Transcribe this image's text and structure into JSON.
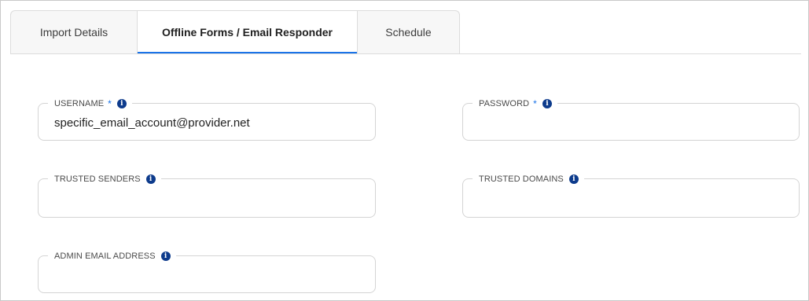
{
  "tabs": [
    {
      "label": "Import Details",
      "active": false
    },
    {
      "label": "Offline Forms / Email Responder",
      "active": true
    },
    {
      "label": "Schedule",
      "active": false
    }
  ],
  "colors": {
    "accent": "#1a73e8",
    "info_icon": "#0d3b8c",
    "border": "#d4d4d4"
  },
  "form": {
    "username": {
      "label": "USERNAME",
      "required_mark": "*",
      "info_icon": "info-icon",
      "value": "specific_email_account@provider.net"
    },
    "password": {
      "label": "PASSWORD",
      "required_mark": "*",
      "info_icon": "info-icon",
      "value": ""
    },
    "trusted_senders": {
      "label": "TRUSTED SENDERS",
      "info_icon": "info-icon",
      "value": ""
    },
    "trusted_domains": {
      "label": "TRUSTED DOMAINS",
      "info_icon": "info-icon",
      "value": ""
    },
    "admin_email": {
      "label": "ADMIN EMAIL ADDRESS",
      "info_icon": "info-icon",
      "value": ""
    }
  }
}
